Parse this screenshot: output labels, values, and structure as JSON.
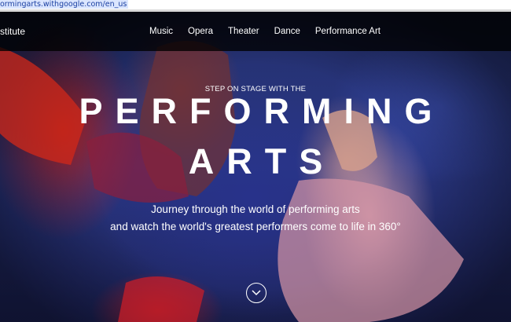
{
  "browser": {
    "url_fragment": "ormingarts.withgoogle.com/en_us"
  },
  "header": {
    "brand": "stitute",
    "nav": [
      "Music",
      "Opera",
      "Theater",
      "Dance",
      "Performance Art"
    ]
  },
  "hero": {
    "kicker": "STEP ON STAGE WITH THE",
    "title_line1": "PERFORMING",
    "title_line2": "ARTS",
    "subtitle_line1": "Journey through the world of performing arts",
    "subtitle_line2": "and watch the world's greatest performers come to life in 360°",
    "scroll_icon": "chevron-down-icon"
  },
  "colors": {
    "navbar_bg": "#000000",
    "text": "#ffffff",
    "url_text": "#1a3fa0"
  }
}
